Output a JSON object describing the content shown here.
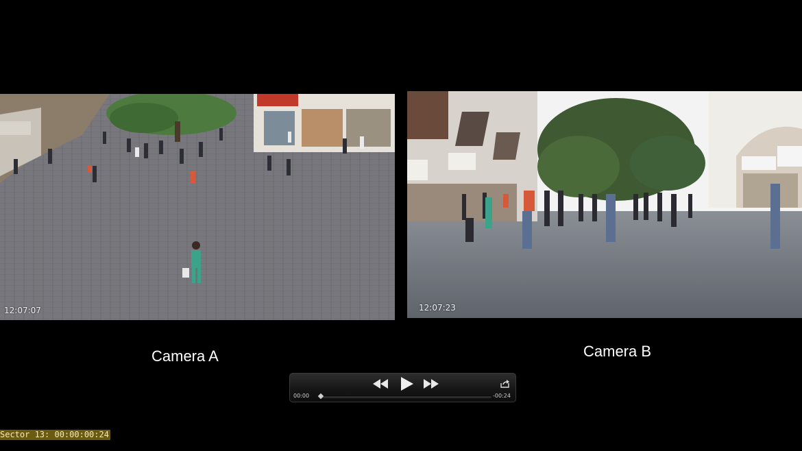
{
  "cameras": [
    {
      "name": "Camera A",
      "timestamp": "12:07:07"
    },
    {
      "name": "Camera B",
      "timestamp": "12:07:23"
    }
  ],
  "player": {
    "current_time": "00:00",
    "remaining_time": "-00:24",
    "progress": 0.0,
    "icons": [
      "rewind-icon",
      "play-icon",
      "fast-forward-icon",
      "share-icon"
    ]
  },
  "overlay": {
    "sector_text": "Sector 13: 00:00:00:24"
  },
  "colors": {
    "background": "#000000",
    "sector_bg": "#6b5a12",
    "sector_text": "#f4e9b6"
  }
}
